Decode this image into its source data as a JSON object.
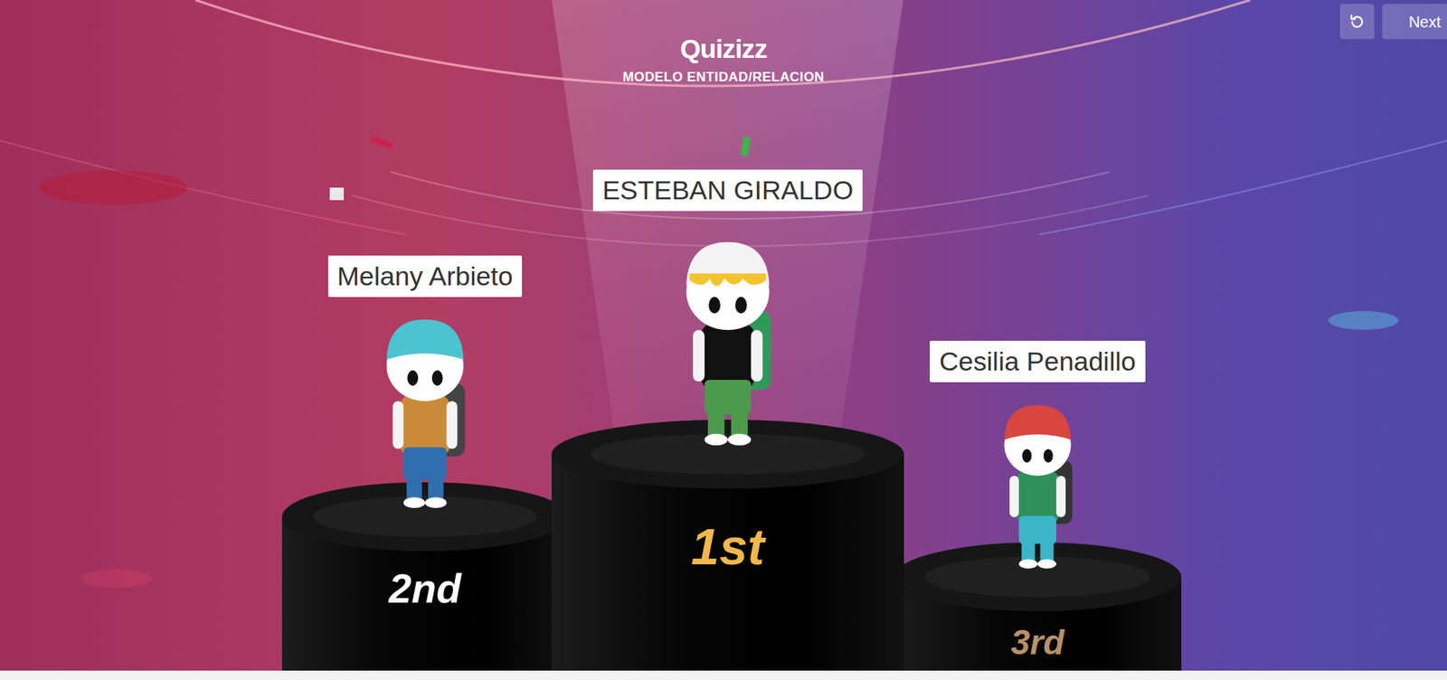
{
  "header": {
    "logo": "Quizizz",
    "title": "MODELO ENTIDAD/RELACION"
  },
  "toolbar": {
    "buttons": [
      "Next"
    ]
  },
  "podium": [
    {
      "rank": "2nd",
      "name": "Melany Arbieto",
      "color": "#ffffff"
    },
    {
      "rank": "1st",
      "name": "ESTEBAN GIRALDO",
      "color": "#f2b84b"
    },
    {
      "rank": "3rd",
      "name": "Cesilia Penadillo",
      "color": "#b8916a"
    }
  ]
}
